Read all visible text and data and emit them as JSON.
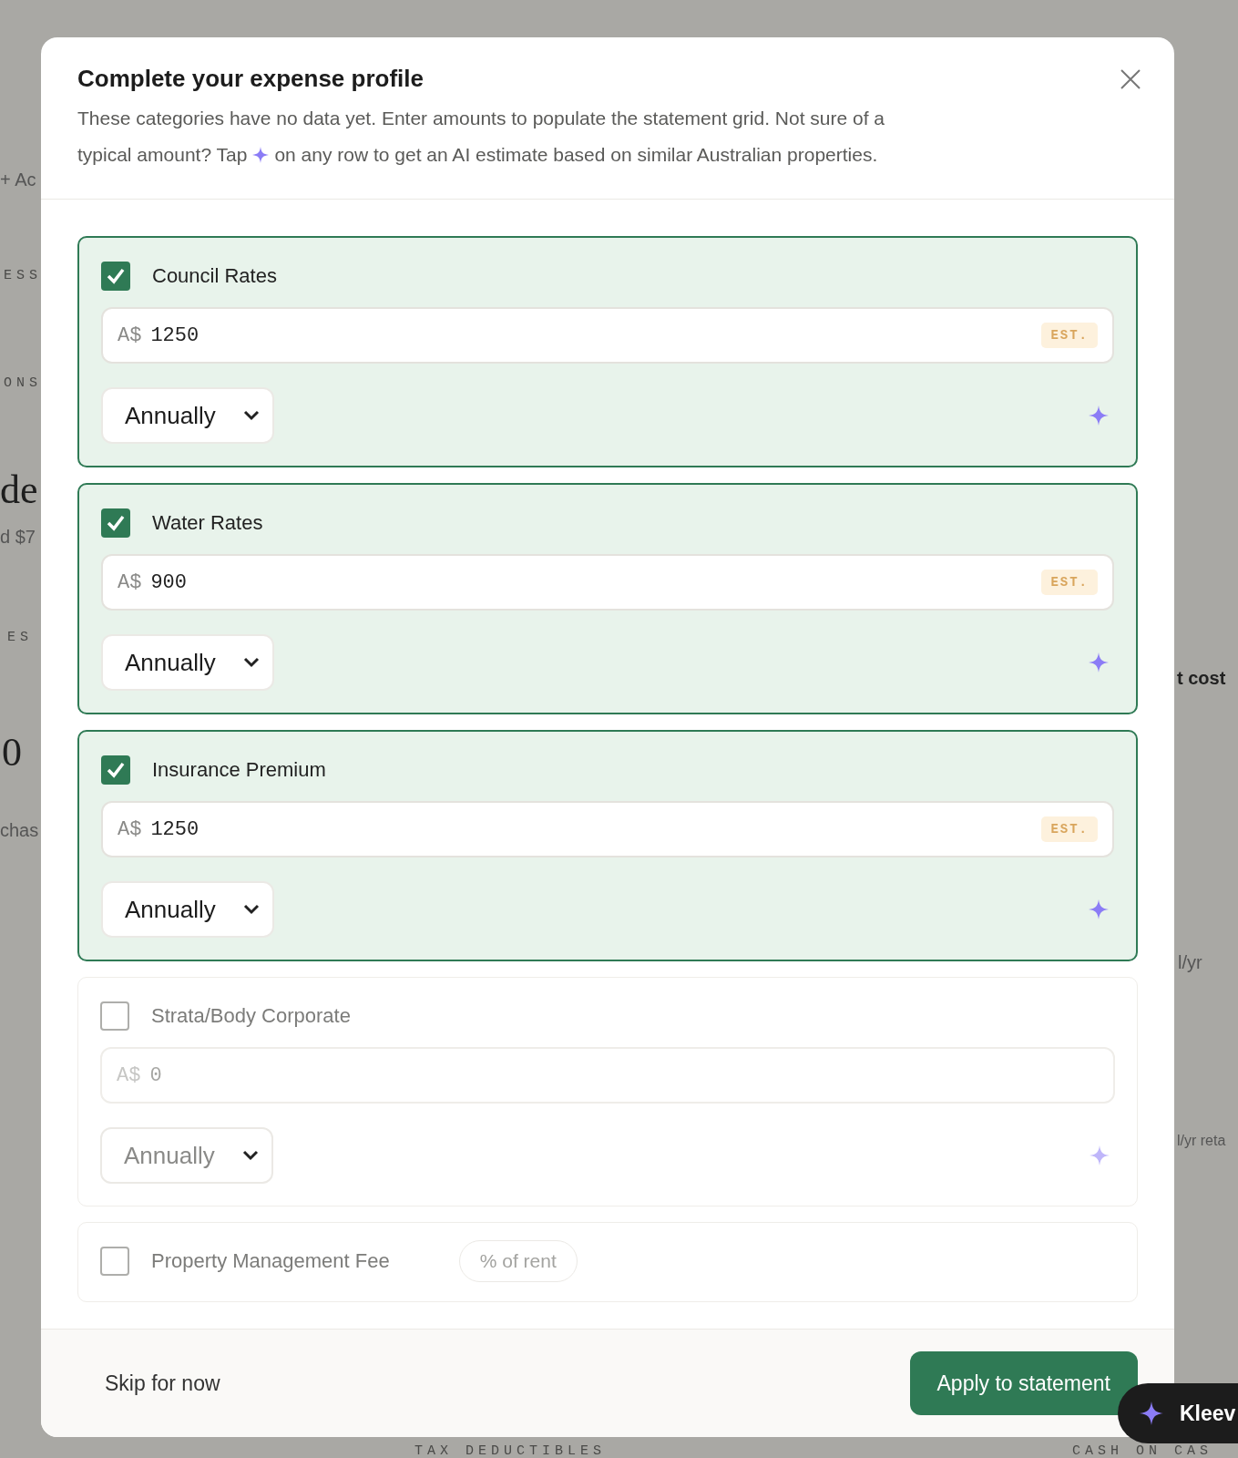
{
  "background": {
    "fragments": [
      {
        "text": "+ Ac",
        "kind": "label"
      },
      {
        "text": "ESS",
        "kind": "caps"
      },
      {
        "text": "ONS",
        "kind": "caps"
      },
      {
        "text": "de",
        "kind": "heading"
      },
      {
        "text": "d $7",
        "kind": "label"
      },
      {
        "text": "ES",
        "kind": "caps"
      },
      {
        "text": "0",
        "kind": "heading"
      },
      {
        "text": "chas",
        "kind": "label"
      },
      {
        "text": "t cost",
        "kind": "strong"
      },
      {
        "text": "l/yr",
        "kind": "label"
      },
      {
        "text": "l/yr reta",
        "kind": "narrow"
      },
      {
        "text": "TAX DEDUCTIBLES",
        "kind": "caps"
      },
      {
        "text": "CASH ON CAS",
        "kind": "caps"
      }
    ]
  },
  "dialog": {
    "title": "Complete your expense profile",
    "description_line": "These categories have no data yet. Enter amounts to populate the statement grid. Not sure of a",
    "description_start": "typical amount? Tap",
    "description_end": "on any row to get an AI estimate based on similar Australian properties.",
    "items": [
      {
        "kind": "amount",
        "label": "Council Rates",
        "checked": true,
        "currency": "A$",
        "value": "1250",
        "badge": "EST.",
        "frequency": "Annually"
      },
      {
        "kind": "amount",
        "label": "Water Rates",
        "checked": true,
        "currency": "A$",
        "value": "900",
        "badge": "EST.",
        "frequency": "Annually"
      },
      {
        "kind": "amount",
        "label": "Insurance Premium",
        "checked": true,
        "currency": "A$",
        "value": "1250",
        "badge": "EST.",
        "frequency": "Annually"
      },
      {
        "kind": "amount",
        "label": "Strata/Body Corporate",
        "checked": false,
        "currency": "A$",
        "placeholder": "0",
        "frequency": "Annually"
      },
      {
        "kind": "percent",
        "label": "Property Management Fee",
        "checked": false,
        "unit_tag": "% of rent"
      }
    ],
    "skip_button": "Skip for now",
    "apply_button": "Apply to statement"
  },
  "assistant": {
    "label": "Kleev"
  }
}
